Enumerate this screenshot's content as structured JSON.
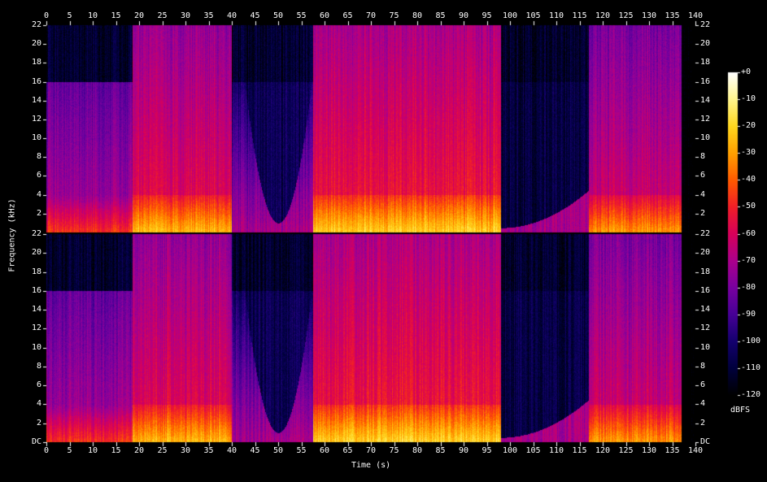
{
  "chart_data": {
    "type": "heatmap",
    "xlabel": "Time (s)",
    "ylabel": "Frequency (kHz)",
    "x_ticks": [
      0,
      5,
      10,
      15,
      20,
      25,
      30,
      35,
      40,
      45,
      50,
      55,
      60,
      65,
      70,
      75,
      80,
      85,
      90,
      95,
      100,
      105,
      110,
      115,
      120,
      125,
      130,
      135,
      140
    ],
    "x_range": [
      0,
      140
    ],
    "y_range_khz": [
      0,
      22
    ],
    "y_ticks_top_channel": [
      "22",
      "20",
      "18",
      "16",
      "14",
      "12",
      "10",
      "8",
      "6",
      "4",
      "2"
    ],
    "y_ticks_bottom_channel": [
      "22",
      "20",
      "18",
      "16",
      "14",
      "12",
      "10",
      "8",
      "6",
      "4",
      "2",
      "DC"
    ],
    "y_tick_values_khz": [
      22,
      20,
      18,
      16,
      14,
      12,
      10,
      8,
      6,
      4,
      2,
      0
    ],
    "channels": 2,
    "colorbar": {
      "label": "dBFS",
      "ticks": [
        "+0",
        "-10",
        "-20",
        "-30",
        "-40",
        "-50",
        "-60",
        "-70",
        "-80",
        "-90",
        "-100",
        "-110",
        "-120"
      ],
      "range_db": [
        -120,
        0
      ]
    },
    "segments": [
      {
        "start": 0,
        "end": 18.5,
        "level_db": -70,
        "cutoff_khz": 16
      },
      {
        "start": 18.5,
        "end": 40,
        "level_db": -55,
        "cutoff_khz": 22
      },
      {
        "start": 40,
        "end": 57.5,
        "level_db": -90,
        "cutoff_khz": 16,
        "dip_center": 50
      },
      {
        "start": 57.5,
        "end": 98,
        "level_db": -50,
        "cutoff_khz": 22
      },
      {
        "start": 98,
        "end": 117,
        "level_db": -100,
        "cutoff_khz": 16
      },
      {
        "start": 117,
        "end": 137,
        "level_db": -60,
        "cutoff_khz": 22
      }
    ],
    "colors": {
      "background": "#000000",
      "low": "#000033",
      "mid": "#cc0044",
      "high": "#ffffcc"
    }
  }
}
